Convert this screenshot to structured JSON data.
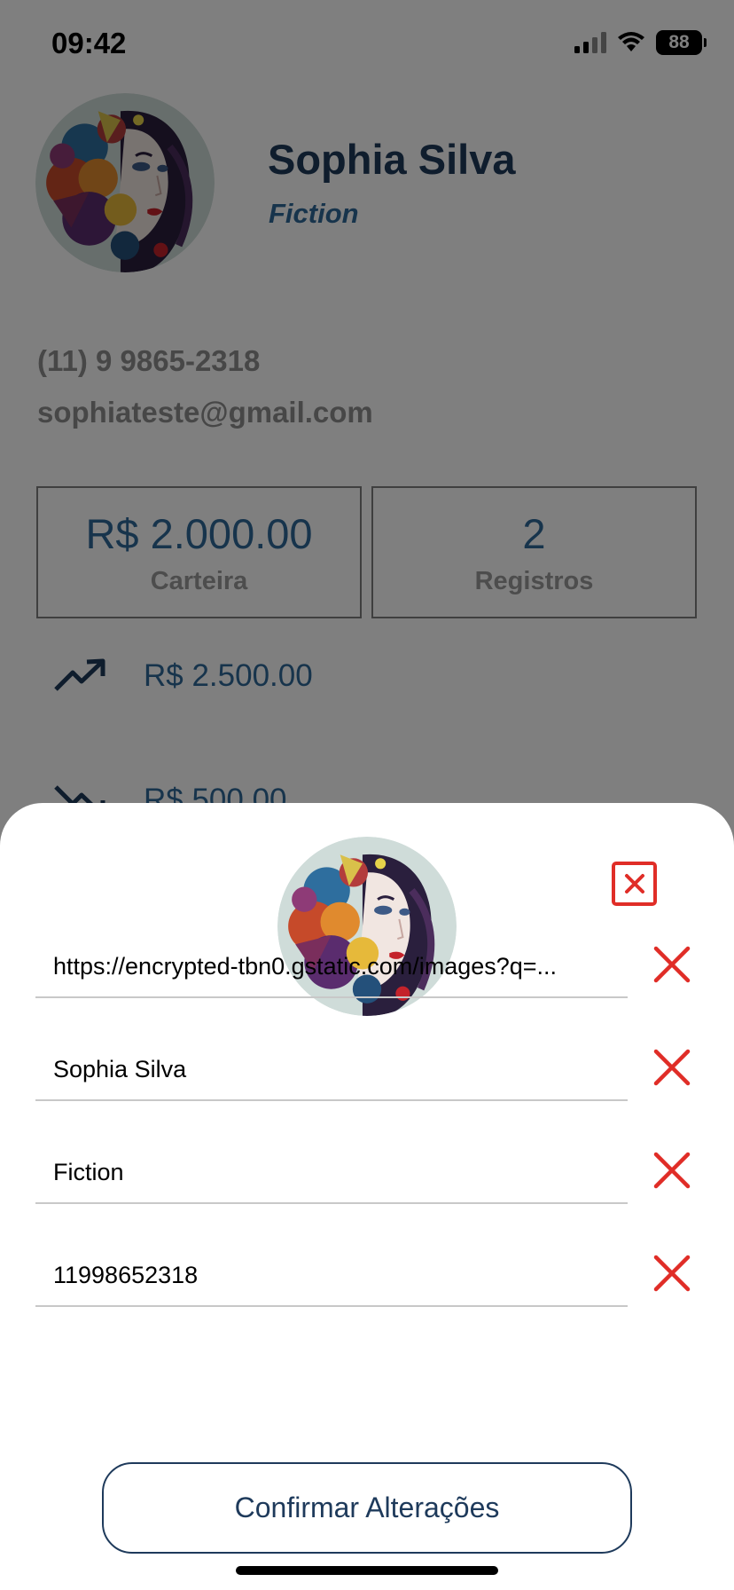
{
  "status_bar": {
    "time": "09:42",
    "battery": "88"
  },
  "profile": {
    "name": "Sophia Silva",
    "genre": "Fiction",
    "phone": "(11) 9 9865-2318",
    "email": "sophiateste@gmail.com"
  },
  "stats": {
    "wallet_value": "R$ 2.000.00",
    "wallet_label": "Carteira",
    "records_value": "2",
    "records_label": "Registros"
  },
  "trends": {
    "income": "R$ 2.500.00",
    "expense": "R$ 500.00"
  },
  "edit_sheet": {
    "fields": [
      {
        "value": "https://encrypted-tbn0.gstatic.com/images?q=..."
      },
      {
        "value": "Sophia Silva"
      },
      {
        "value": "Fiction"
      },
      {
        "value": "11998652318"
      }
    ],
    "confirm_label": "Confirmar Alterações"
  },
  "colors": {
    "navy": "#1e3a5b",
    "blue": "#2f6898",
    "danger_red": "#e02d27",
    "muted_gray": "#8f8f8f"
  },
  "icons": [
    "signal-icon",
    "wifi-icon",
    "battery-icon",
    "trending-up-icon",
    "trending-down-icon",
    "close-box-icon",
    "x-icon"
  ]
}
